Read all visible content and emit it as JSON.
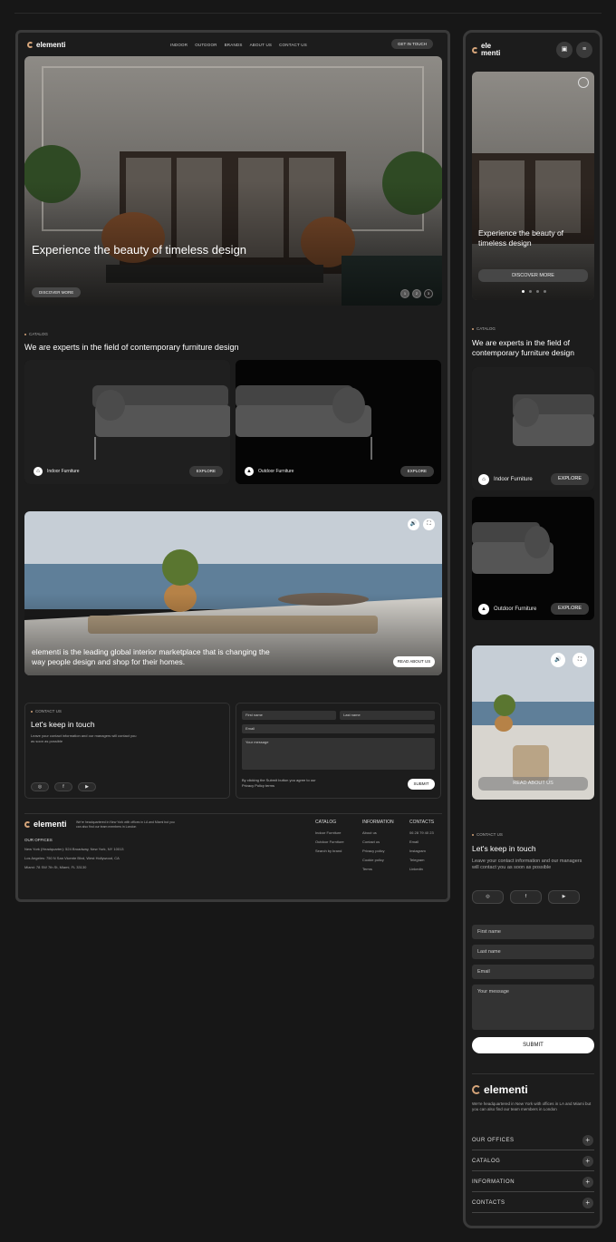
{
  "brand": {
    "name": "elementi",
    "accent": "#d6a57a",
    "mobile_name_l1": "ele",
    "mobile_name_l2": "menti"
  },
  "nav": {
    "items": [
      "INDOOR",
      "OUTDOOR",
      "BRANDS",
      "ABOUT US",
      "CONTACT US"
    ],
    "cta": "GET IN TOUCH"
  },
  "hero": {
    "title": "Experience the beauty of timeless design",
    "button": "DISCOVER MORE",
    "slides": [
      "1",
      "2",
      "3"
    ]
  },
  "catalog": {
    "eyebrow": "CATALOG",
    "title": "We are experts in the field of contemporary furniture design",
    "cards": [
      {
        "label": "Indoor Furniture",
        "button": "EXPLORE",
        "icon": "house-icon"
      },
      {
        "label": "Outdoor Furniture",
        "button": "EXPLORE",
        "icon": "tree-icon"
      }
    ]
  },
  "about": {
    "text": "elementi is the leading global interior marketplace that is changing the way people design and shop for their homes.",
    "button": "READ ABOUT US"
  },
  "contact": {
    "eyebrow": "CONTACT US",
    "title": "Let's keep in touch",
    "desc": "Leave your contact information and our managers will contact you as soon as possible",
    "fields": {
      "first": "First name",
      "last": "Last name",
      "email": "Email",
      "message": "Your message"
    },
    "consent": "By clicking the Submit button you agree to our Privacy Policy terms",
    "submit": "SUBMIT",
    "social": [
      "instagram-icon",
      "facebook-icon",
      "youtube-icon"
    ]
  },
  "footer": {
    "tagline": "We're headquartered in New York with offices in LA and Miami but you can also find our team members in London",
    "offices_title": "OUR OFFICES",
    "offices": [
      "New York (Headquarter): 524 Broadway, New York, NY 10013",
      "Los Angeles: 750 N San Vicente Blvd, West Hollywood, CA",
      "Miami: 78 SW 7th St, Miami, FL 33130"
    ],
    "catalog": {
      "title": "CATALOG",
      "items": [
        "Indoor Furniture",
        "Outdoor Furniture",
        "Search by brand"
      ]
    },
    "information": {
      "title": "INFORMATION",
      "items": [
        "About us",
        "Contact us",
        "Privacy policy",
        "Cookie policy",
        "Terms"
      ]
    },
    "contacts": {
      "title": "CONTACTS",
      "items": [
        "06 28 79 40 23",
        "Email",
        "Instagram",
        "Telegram",
        "Linkedin"
      ]
    },
    "accordion": [
      "OUR OFFICES",
      "CATALOG",
      "INFORMATION",
      "CONTACTS"
    ]
  },
  "colors": {
    "bg": "#171717",
    "panel": "#1c1c1c",
    "pill": "#3a3a3a"
  }
}
